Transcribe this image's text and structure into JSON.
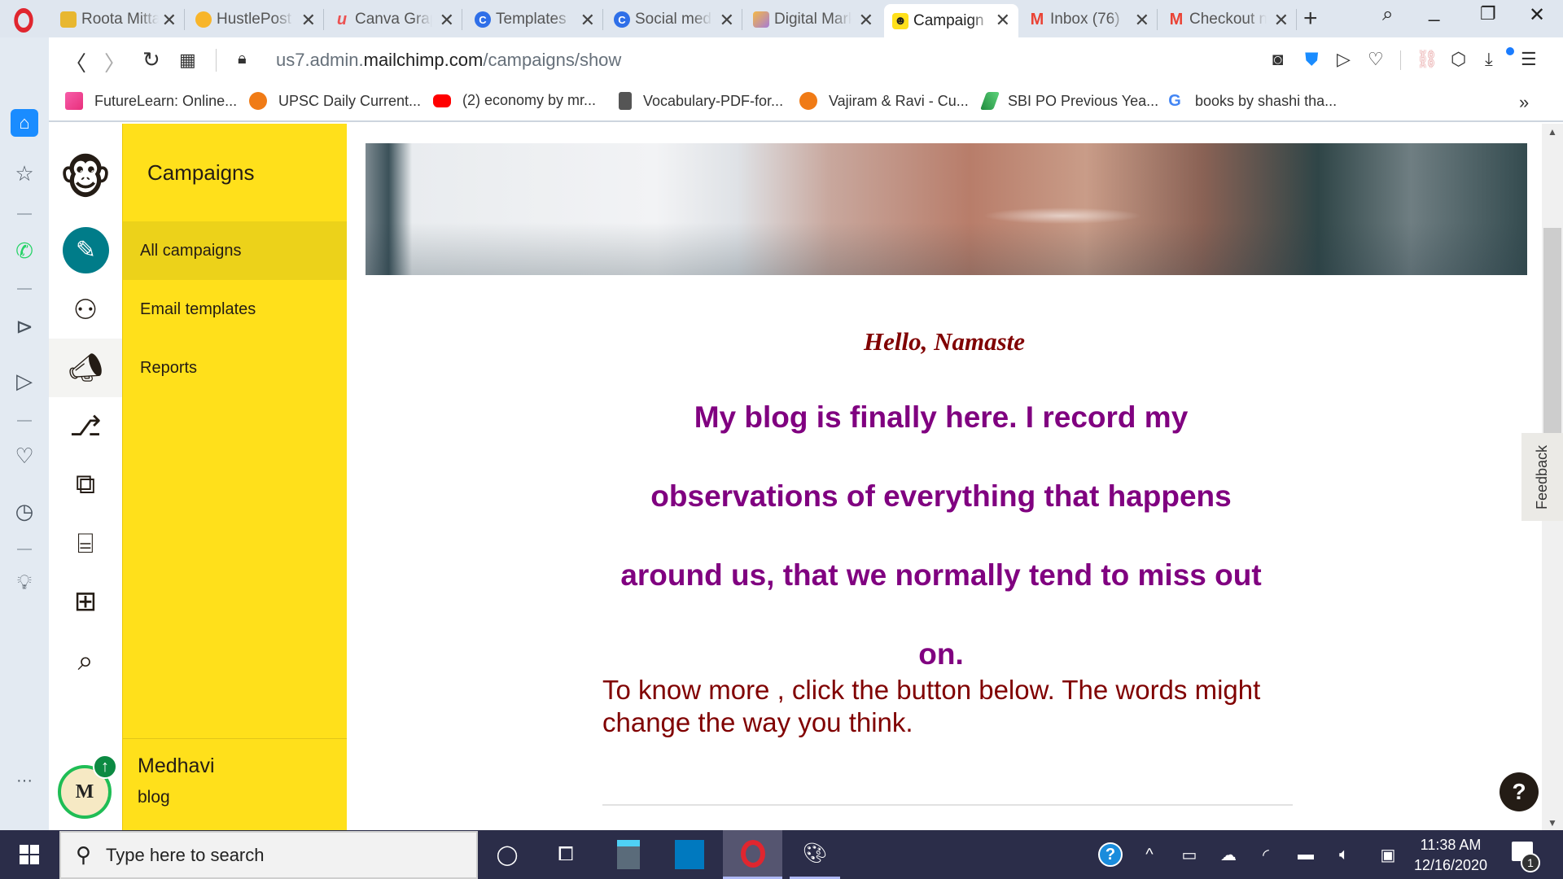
{
  "browser": {
    "tabs": [
      {
        "title": "Roota Mitta",
        "icon": "roota-favicon",
        "color": "#e8b730"
      },
      {
        "title": "HustlePost",
        "icon": "hustlepost-favicon",
        "color": "#f8b52a"
      },
      {
        "title": "Canva Graphics",
        "icon": "udemy-favicon",
        "color": "#ec5252"
      },
      {
        "title": "Templates",
        "icon": "canva-favicon",
        "color": "#2f6fe8"
      },
      {
        "title": "Social media",
        "icon": "canva-favicon",
        "color": "#2f6fe8"
      },
      {
        "title": "Digital Marketing",
        "icon": "digital-favicon",
        "color": "#a67cd6"
      },
      {
        "title": "Campaign",
        "icon": "mailchimp-favicon",
        "color": "#ffe01b",
        "active": true
      },
      {
        "title": "Inbox (76)",
        "icon": "gmail-favicon",
        "color": "#ea4335"
      },
      {
        "title": "Checkout n",
        "icon": "gmail-favicon",
        "color": "#ea4335"
      }
    ],
    "url_prefix": "us7.admin.",
    "url_domain": "mailchimp.com",
    "url_path": "/campaigns/show",
    "bookmarks": [
      {
        "label": "FutureLearn: Online...",
        "color": "#e8398e"
      },
      {
        "label": "UPSC Daily Current...",
        "color": "#f07b16"
      },
      {
        "label": "(2) economy by mr...",
        "color": "#ff0000"
      },
      {
        "label": "Vocabulary-PDF-for...",
        "color": "#555555"
      },
      {
        "label": "Vajiram & Ravi - Cu...",
        "color": "#f07b16"
      },
      {
        "label": "SBI PO Previous Yea...",
        "color": "#2a9d4a"
      },
      {
        "label": "books by shashi tha...",
        "color": "#4285f4"
      }
    ],
    "bookmarks_more": "»"
  },
  "mailchimp": {
    "section_title": "Campaigns",
    "nav": [
      {
        "label": "All campaigns",
        "active": true
      },
      {
        "label": "Email templates"
      },
      {
        "label": "Reports"
      }
    ],
    "account": {
      "name": "Medhavi",
      "subtitle": "blog",
      "avatar_letter": "M"
    },
    "feedback_label": "Feedback",
    "help_label": "?"
  },
  "email": {
    "greeting": "Hello, Namaste",
    "blog_text": "My blog is finally here. I record my observations of everything that happens around us, that we normally tend to miss out on.",
    "blog_lines": [
      "My blog is finally here. I record my",
      "observations of everything that happens",
      "around us, that we normally tend to miss out",
      "on."
    ],
    "cta_text": "To know more , click the button below. The words might change the way you think.",
    "colors": {
      "greeting": "#800000",
      "blog": "#800080",
      "cta": "#800000"
    }
  },
  "taskbar": {
    "search_placeholder": "Type here to search",
    "time": "11:38 AM",
    "date": "12/16/2020",
    "notification_count": "1"
  },
  "colors": {
    "mailchimp_yellow": "#ffe01b",
    "mailchimp_teal": "#007c89",
    "taskbar": "#2b2d49"
  }
}
